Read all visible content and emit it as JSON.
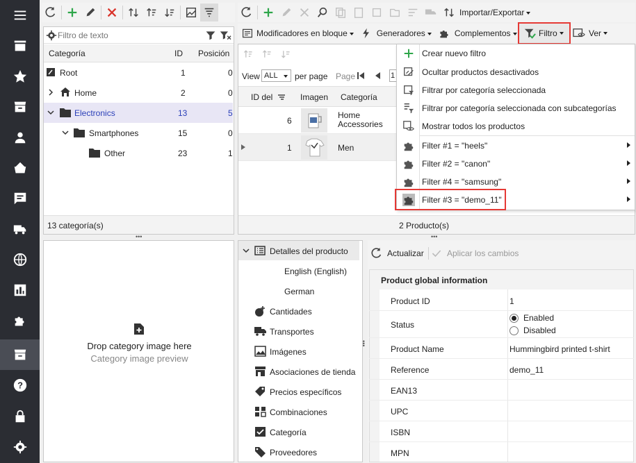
{
  "leftnav": {
    "items": [
      "menu-icon",
      "store-icon",
      "star-icon",
      "box-icon",
      "user-icon",
      "basket-icon",
      "message-icon",
      "truck-icon",
      "globe-icon",
      "chart-icon",
      "puzzle-icon",
      "catalog-icon",
      "help-icon",
      "lock-icon",
      "gear-icon"
    ]
  },
  "category_panel": {
    "filter_placeholder": "Filtro de texto",
    "headers": {
      "category": "Categoría",
      "id": "ID",
      "position": "Posición"
    },
    "rows": [
      {
        "name": "Root",
        "id": "1",
        "pos": "0"
      },
      {
        "name": "Home",
        "id": "2",
        "pos": "0"
      },
      {
        "name": "Electronics",
        "id": "13",
        "pos": "5"
      },
      {
        "name": "Smartphones",
        "id": "15",
        "pos": "0"
      },
      {
        "name": "Other",
        "id": "23",
        "pos": "1"
      }
    ],
    "status": "13 categoría(s)"
  },
  "image_panel": {
    "drop_text": "Drop category image here",
    "preview_text": "Category image preview"
  },
  "product_toolbar": {
    "import_export": "Importar/Exportar",
    "bulk_modifiers": "Modificadores en bloque",
    "generators": "Generadores",
    "addons": "Complementos",
    "filter": "Filtro",
    "view": "Ver"
  },
  "product_grid": {
    "view_label": "View",
    "view_value": "ALL",
    "per_page": "per page",
    "page_label": "Page",
    "page_value": "1",
    "headers": {
      "id": "ID del",
      "image": "Imagen",
      "category": "Categoría"
    },
    "rows": [
      {
        "id": "6",
        "category": "Home Accessories"
      },
      {
        "id": "1",
        "category": "Men"
      }
    ],
    "status": "2 Producto(s)"
  },
  "filter_menu": {
    "items": [
      {
        "label": "Crear nuevo filtro",
        "icon": "plus-icon",
        "submenu": false
      },
      {
        "label": "Ocultar productos desactivados",
        "icon": "hide-icon",
        "submenu": false
      },
      {
        "label": "Filtrar por categoría seleccionada",
        "icon": "category-filter-icon",
        "submenu": false
      },
      {
        "label": "Filtrar por categoría seleccionada con subcategorías",
        "icon": "subcategory-filter-icon",
        "submenu": false
      },
      {
        "label": "Mostrar todos los productos",
        "icon": "show-all-icon",
        "submenu": false
      },
      {
        "label": "Filter #1 = \"heels\"",
        "icon": "puzzle-icon",
        "submenu": true
      },
      {
        "label": "Filter #2 = \"canon\"",
        "icon": "puzzle-icon",
        "submenu": true
      },
      {
        "label": "Filter #4 = \"samsung\"",
        "icon": "puzzle-icon",
        "submenu": true
      },
      {
        "label": "Filter #3 = \"demo_11\"",
        "icon": "puzzle-icon",
        "submenu": true
      }
    ]
  },
  "details_tree": {
    "items": [
      {
        "label": "Detalles del producto"
      },
      {
        "label": "English (English)"
      },
      {
        "label": "German"
      },
      {
        "label": "Cantidades"
      },
      {
        "label": "Transportes"
      },
      {
        "label": "Imágenes"
      },
      {
        "label": "Asociaciones de tienda"
      },
      {
        "label": "Precios específicos"
      },
      {
        "label": "Combinaciones"
      },
      {
        "label": "Categoría"
      },
      {
        "label": "Proveedores"
      }
    ]
  },
  "details_panel": {
    "refresh": "Actualizar",
    "apply": "Aplicar los cambios",
    "section": "Product global information",
    "product_id_label": "Product ID",
    "product_id": "1",
    "status_label": "Status",
    "enabled": "Enabled",
    "disabled": "Disabled",
    "status_value": "enabled",
    "name_label": "Product Name",
    "name": "Hummingbird printed t-shirt",
    "reference_label": "Reference",
    "reference": "demo_11",
    "ean_label": "EAN13",
    "upc_label": "UPC",
    "isbn_label": "ISBN",
    "mpn_label": "MPN"
  },
  "colors": {
    "sidebar": "#2b2d33",
    "highlight": "#e8e6f5",
    "accent_red": "#e53935",
    "link_blue": "#2a3fb8"
  }
}
